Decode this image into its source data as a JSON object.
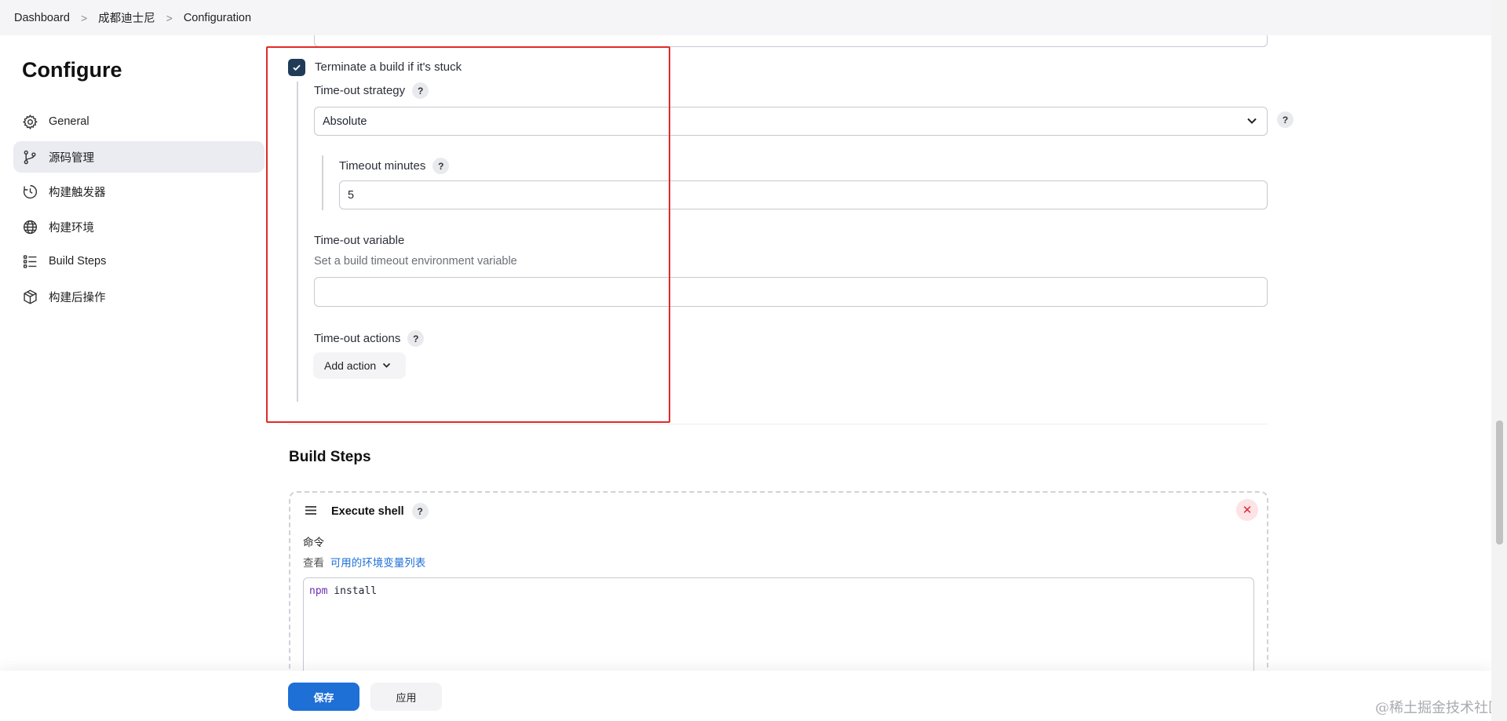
{
  "breadcrumb": [
    "Dashboard",
    "成都迪士尼",
    "Configuration"
  ],
  "sidebar": {
    "title": "Configure",
    "items": [
      {
        "label": "General",
        "icon": "gear-icon"
      },
      {
        "label": "源码管理",
        "icon": "branch-icon",
        "active": true
      },
      {
        "label": "构建触发器",
        "icon": "clock-icon"
      },
      {
        "label": "构建环境",
        "icon": "globe-icon"
      },
      {
        "label": "Build Steps",
        "icon": "list-icon"
      },
      {
        "label": "构建后操作",
        "icon": "package-icon"
      }
    ]
  },
  "stuck": {
    "checkbox_label": "Terminate a build if it's stuck",
    "checked": true,
    "strategy_label": "Time-out strategy",
    "strategy_value": "Absolute",
    "minutes_label": "Timeout minutes",
    "minutes_value": "5",
    "variable_label": "Time-out variable",
    "variable_desc": "Set a build timeout environment variable",
    "variable_value": "",
    "actions_label": "Time-out actions",
    "add_action_label": "Add action"
  },
  "help_mark": "?",
  "build_steps": {
    "title": "Build Steps",
    "step_title": "Execute shell",
    "close_symbol": "✕",
    "command_label": "命令",
    "env_prefix": "查看",
    "env_link": "可用的环境变量列表",
    "command_keyword": "npm",
    "command_rest": " install"
  },
  "actions": {
    "save": "保存",
    "apply": "应用"
  },
  "watermark": "@稀土掘金技术社区",
  "colors": {
    "primary": "#1e6fd6",
    "checkbox": "#1f3b57",
    "highlight": "#e02b27",
    "link": "#1e6fd6"
  }
}
